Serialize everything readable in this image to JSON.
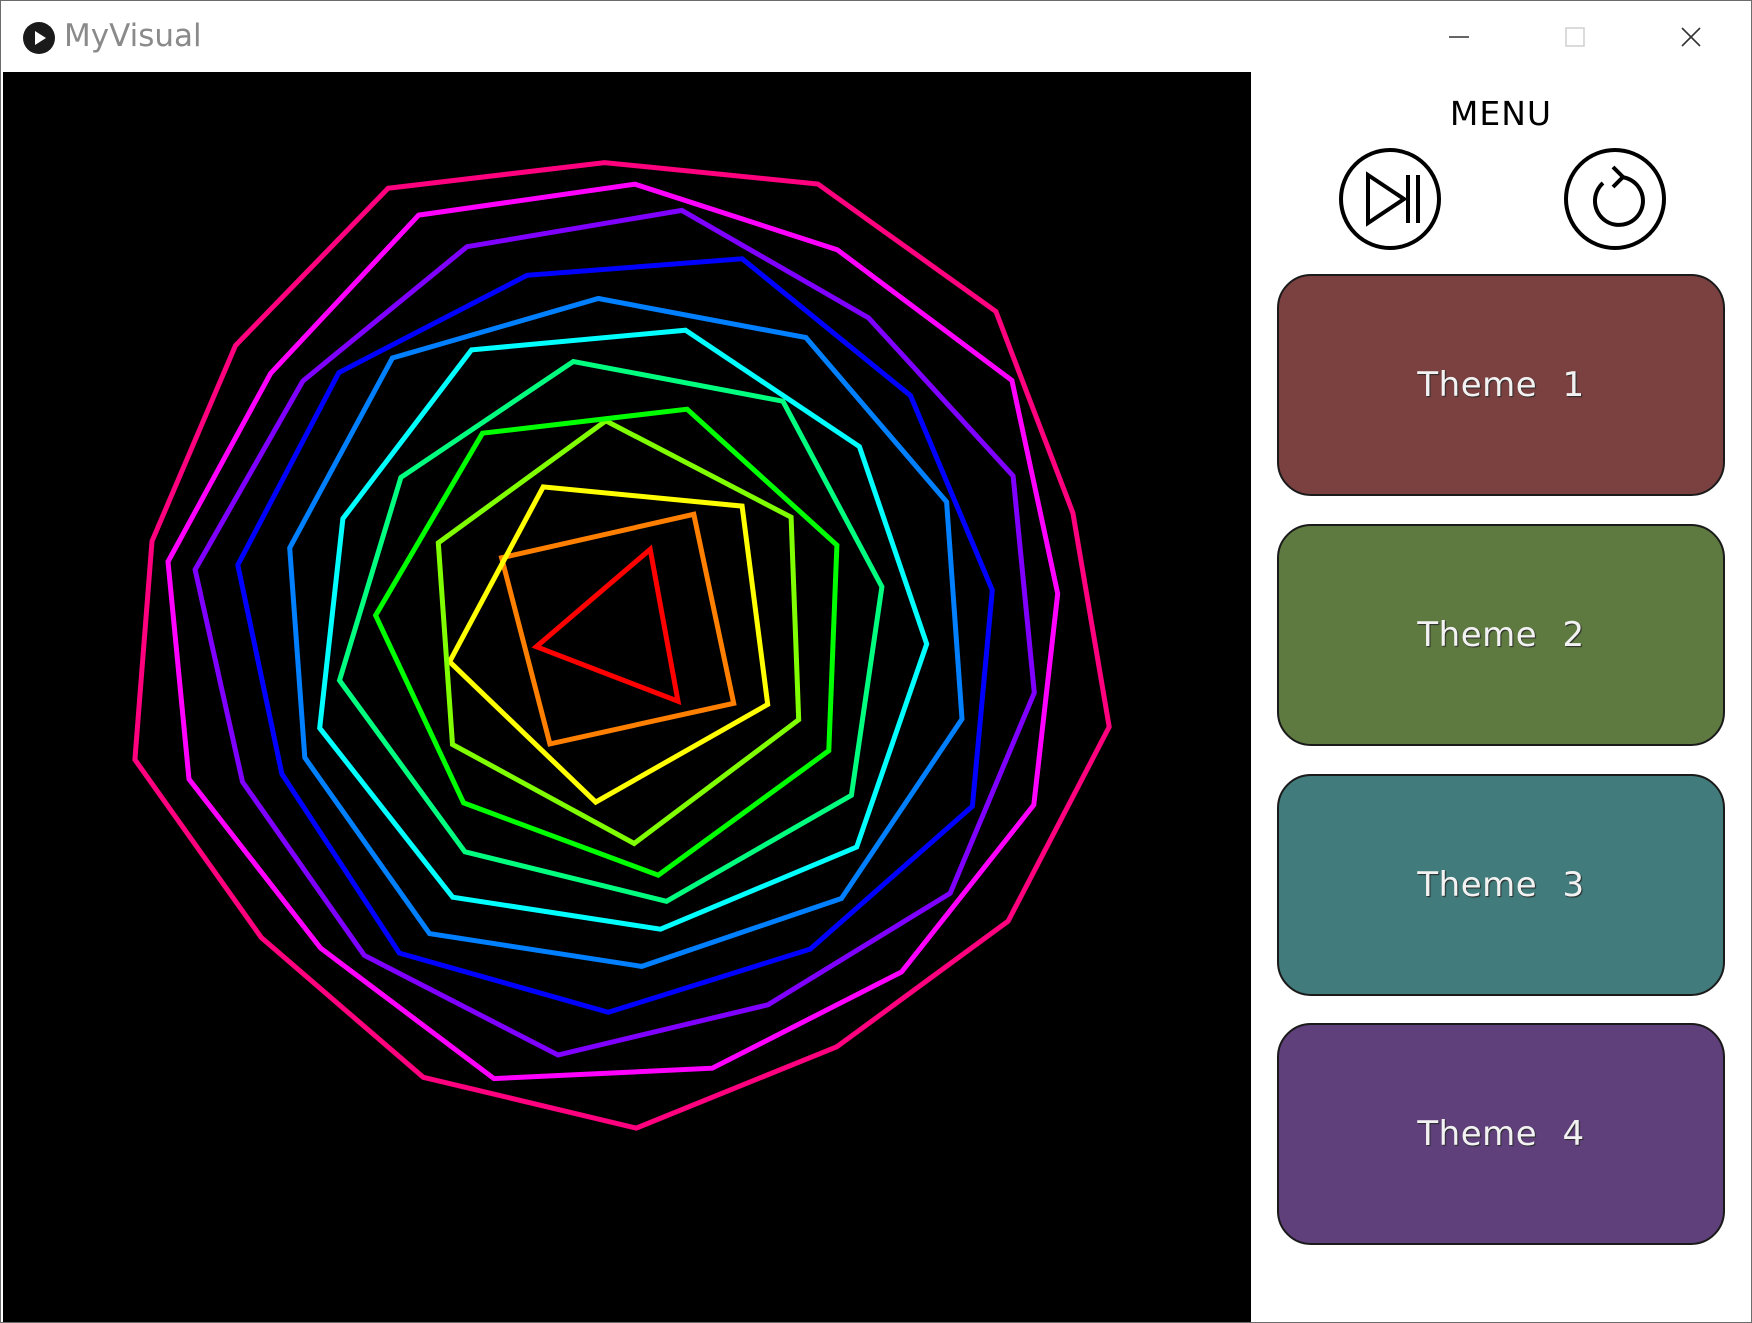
{
  "window": {
    "title": "MyVisual",
    "icon": "play-circle-icon"
  },
  "controls": {
    "minimize_icon": "minimize-icon",
    "maximize_icon": "maximize-icon",
    "close_icon": "close-icon"
  },
  "menu": {
    "title": "MENU",
    "skip_icon": "skip-forward-icon",
    "reset_icon": "restart-icon",
    "themes": [
      {
        "label": "Theme 1",
        "color": "#7b4141"
      },
      {
        "label": "Theme 2",
        "color": "#5f7a41"
      },
      {
        "label": "Theme 3",
        "color": "#417b7b"
      },
      {
        "label": "Theme 4",
        "color": "#5f407b"
      }
    ]
  },
  "visualizer": {
    "background": "#000000",
    "polygons": [
      {
        "sides": 3,
        "color": "#ff0000"
      },
      {
        "sides": 4,
        "color": "#ff7f00"
      },
      {
        "sides": 5,
        "color": "#ffff00"
      },
      {
        "sides": 6,
        "color": "#7fff00"
      },
      {
        "sides": 7,
        "color": "#00ff00"
      },
      {
        "sides": 8,
        "color": "#00ff7f"
      },
      {
        "sides": 9,
        "color": "#00ffff"
      },
      {
        "sides": 10,
        "color": "#007fff"
      },
      {
        "sides": 11,
        "color": "#0000ff"
      },
      {
        "sides": 12,
        "color": "#7f00ff"
      },
      {
        "sides": 13,
        "color": "#ff00ff"
      },
      {
        "sides": 14,
        "color": "#ff007f"
      }
    ]
  }
}
